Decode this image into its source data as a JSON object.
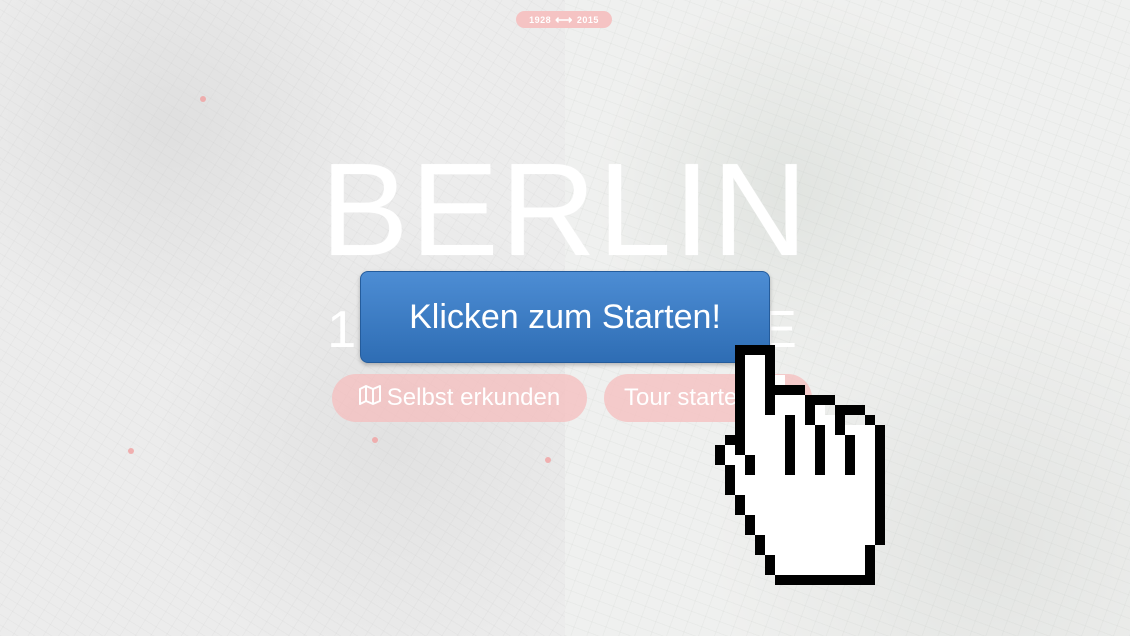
{
  "header": {
    "year_from": "1928",
    "year_to": "2015",
    "arrow_icon": "double-arrow-icon"
  },
  "hero": {
    "title": "BERLIN",
    "subtitle_left": "1",
    "subtitle_right": "E"
  },
  "actions": {
    "explore_label": "Selbst erkunden",
    "explore_icon": "map-icon",
    "tour_label": "Tour starten"
  },
  "overlay": {
    "start_label": "Klicken zum Starten!",
    "cursor_icon": "hand-pointer-icon"
  },
  "colors": {
    "accent_pink": "#f5c3c3",
    "button_blue": "#3a7cc6"
  }
}
